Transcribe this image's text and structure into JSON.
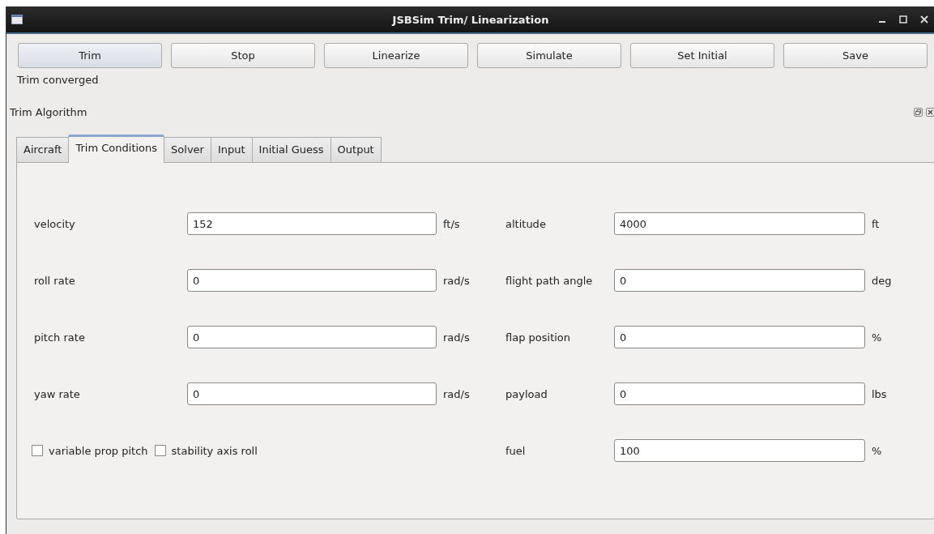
{
  "window": {
    "title": "JSBSim Trim/ Linearization"
  },
  "buttons": [
    {
      "label": "Trim",
      "selected": true
    },
    {
      "label": "Stop",
      "selected": false
    },
    {
      "label": "Linearize",
      "selected": false
    },
    {
      "label": "Simulate",
      "selected": false
    },
    {
      "label": "Set Initial",
      "selected": false
    },
    {
      "label": "Save",
      "selected": false
    }
  ],
  "status": "Trim converged",
  "dock": {
    "title": "Trim Algorithm"
  },
  "tabs": [
    {
      "label": "Aircraft",
      "selected": false
    },
    {
      "label": "Trim Conditions",
      "selected": true
    },
    {
      "label": "Solver",
      "selected": false
    },
    {
      "label": "Input",
      "selected": false
    },
    {
      "label": "Initial Guess",
      "selected": false
    },
    {
      "label": "Output",
      "selected": false
    }
  ],
  "left_fields": [
    {
      "label": "velocity",
      "value": "152",
      "unit": "ft/s"
    },
    {
      "label": "roll rate",
      "value": "0",
      "unit": "rad/s"
    },
    {
      "label": "pitch rate",
      "value": "0",
      "unit": "rad/s"
    },
    {
      "label": "yaw rate",
      "value": "0",
      "unit": "rad/s"
    }
  ],
  "checkboxes": [
    {
      "label": "variable prop pitch",
      "checked": false
    },
    {
      "label": "stability axis roll",
      "checked": false
    }
  ],
  "right_fields": [
    {
      "label": "altitude",
      "value": "4000",
      "unit": "ft"
    },
    {
      "label": "flight path angle",
      "value": "0",
      "unit": "deg"
    },
    {
      "label": "flap position",
      "value": "0",
      "unit": "%"
    },
    {
      "label": "payload",
      "value": "0",
      "unit": "lbs"
    },
    {
      "label": "fuel",
      "value": "100",
      "unit": "%"
    }
  ]
}
